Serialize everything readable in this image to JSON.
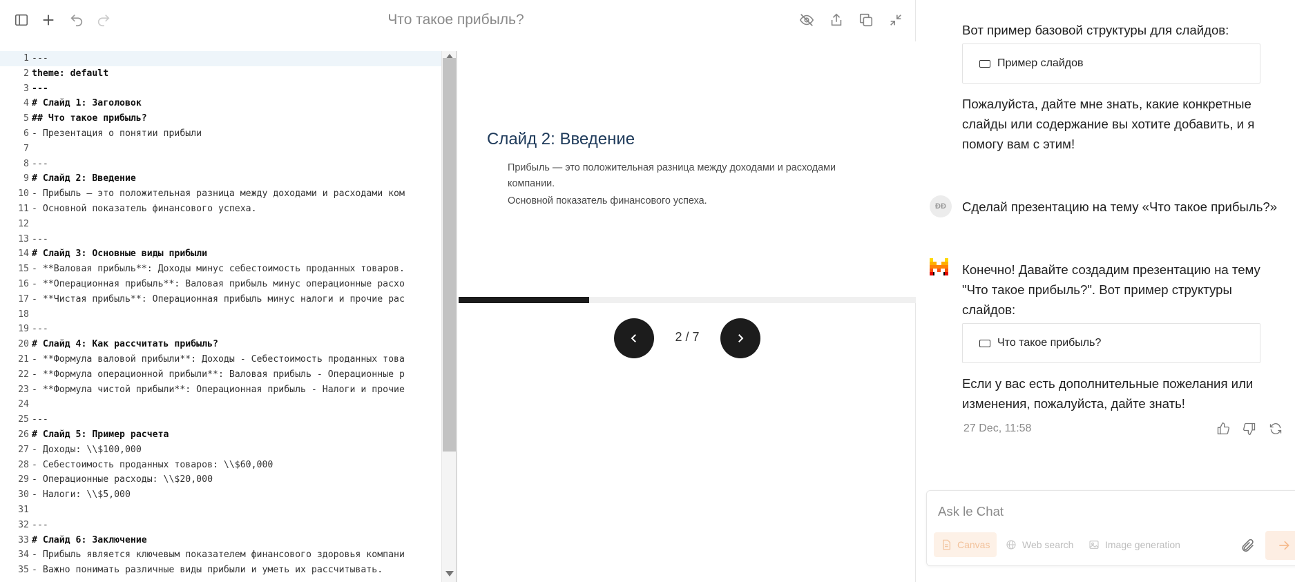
{
  "canvas": {
    "title": "Что такое прибыль?",
    "toolbar": {
      "left": [
        "sidebar-toggle-icon",
        "plus-icon",
        "undo-icon",
        "redo-icon"
      ],
      "right": [
        "eye-off-icon",
        "share-icon",
        "copy-icon",
        "minimize-icon"
      ]
    },
    "editor": {
      "active_line": 1,
      "lines": [
        {
          "n": "1",
          "text": "---",
          "bold": false
        },
        {
          "n": "2",
          "text": "theme: default",
          "bold": true
        },
        {
          "n": "3",
          "text": "---",
          "bold": true
        },
        {
          "n": "4",
          "text": "# Слайд 1: Заголовок",
          "bold": true
        },
        {
          "n": "5",
          "text": "## Что такое прибыль?",
          "bold": true
        },
        {
          "n": "6",
          "text": "- Презентация о понятии прибыли",
          "bold": false
        },
        {
          "n": "7",
          "text": "",
          "bold": false
        },
        {
          "n": "8",
          "text": "---",
          "bold": false
        },
        {
          "n": "9",
          "text": "# Слайд 2: Введение",
          "bold": true
        },
        {
          "n": "10",
          "text": "- Прибыль — это положительная разница между доходами и расходами ком",
          "bold": false
        },
        {
          "n": "11",
          "text": "- Основной показатель финансового успеха.",
          "bold": false
        },
        {
          "n": "12",
          "text": "",
          "bold": false
        },
        {
          "n": "13",
          "text": "---",
          "bold": false
        },
        {
          "n": "14",
          "text": "# Слайд 3: Основные виды прибыли",
          "bold": true
        },
        {
          "n": "15",
          "text": "- **Валовая прибыль**: Доходы минус себестоимость проданных товаров.",
          "bold": false
        },
        {
          "n": "16",
          "text": "- **Операционная прибыль**: Валовая прибыль минус операционные расхо",
          "bold": false
        },
        {
          "n": "17",
          "text": "- **Чистая прибыль**: Операционная прибыль минус налоги и прочие рас",
          "bold": false
        },
        {
          "n": "18",
          "text": "",
          "bold": false
        },
        {
          "n": "19",
          "text": "---",
          "bold": false
        },
        {
          "n": "20",
          "text": "# Слайд 4: Как рассчитать прибыль?",
          "bold": true
        },
        {
          "n": "21",
          "text": "- **Формула валовой прибыли**: Доходы - Себестоимость проданных това",
          "bold": false
        },
        {
          "n": "22",
          "text": "- **Формула операционной прибыли**: Валовая прибыль - Операционные р",
          "bold": false
        },
        {
          "n": "23",
          "text": "- **Формула чистой прибыли**: Операционная прибыль - Налоги и прочие",
          "bold": false
        },
        {
          "n": "24",
          "text": "",
          "bold": false
        },
        {
          "n": "25",
          "text": "---",
          "bold": false
        },
        {
          "n": "26",
          "text": "# Слайд 5: Пример расчета",
          "bold": true
        },
        {
          "n": "27",
          "text": "- Доходы: \\\\$100,000",
          "bold": false
        },
        {
          "n": "28",
          "text": "- Себестоимость проданных товаров: \\\\$60,000",
          "bold": false
        },
        {
          "n": "29",
          "text": "- Операционные расходы: \\\\$20,000",
          "bold": false
        },
        {
          "n": "30",
          "text": "- Налоги: \\\\$5,000",
          "bold": false
        },
        {
          "n": "31",
          "text": "",
          "bold": false
        },
        {
          "n": "32",
          "text": "---",
          "bold": false
        },
        {
          "n": "33",
          "text": "# Слайд 6: Заключение",
          "bold": true
        },
        {
          "n": "34",
          "text": "- Прибыль является ключевым показателем финансового здоровья компани",
          "bold": false
        },
        {
          "n": "35",
          "text": "- Важно понимать различные виды прибыли и уметь их рассчитывать.",
          "bold": false
        }
      ]
    },
    "slide": {
      "title": "Слайд 2: Введение",
      "bullets": [
        "Прибыль — это положительная разница между доходами и расходами компании.",
        "Основной показатель финансового успеха."
      ],
      "current": 2,
      "total": 7,
      "indicator": "2 / 7"
    }
  },
  "chat": {
    "messages": {
      "assistant_intro": "Вот пример базовой структуры для слайдов:",
      "artifact_1": "Пример слайдов",
      "assistant_followup": "Пожалуйста, дайте мне знать, какие конкретные слайды или содержание вы хотите добавить, и я помогу вам с этим!",
      "user_initials": "ĐĐ",
      "user_message": "Сделай презентацию на тему «Что такое прибыль?»",
      "assistant_reply": "Конечно! Давайте создадим презентацию на тему \"Что такое прибыль?\". Вот пример структуры слайдов:",
      "artifact_2": "Что такое прибыль?",
      "assistant_closing": "Если у вас есть дополнительные пожелания или изменения, пожалуйста, дайте знать!",
      "timestamp": "27 Dec, 11:58"
    },
    "input": {
      "placeholder": "Ask le Chat",
      "value": ""
    },
    "tools": {
      "canvas": "Canvas",
      "web_search": "Web search",
      "image_generation": "Image generation"
    },
    "colors": {
      "accent": "#fa7d19",
      "accent_soft": "#fdf1e7"
    }
  }
}
